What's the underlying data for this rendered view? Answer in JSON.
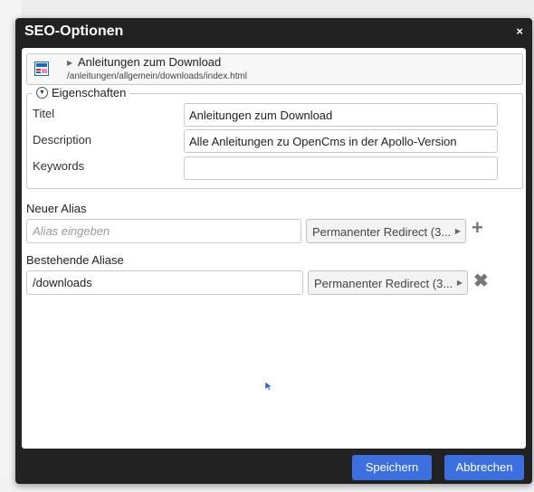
{
  "dialog": {
    "title": "SEO-Optionen",
    "close_glyph": "×",
    "resource": {
      "icon": "page-icon",
      "title": "Anleitungen zum Download",
      "path": "/anleitungen/allgemein/downloads/index.html"
    },
    "properties": {
      "legend": "Eigenschaften",
      "fields": [
        {
          "label": "Titel",
          "value": "Anleitungen zum Download"
        },
        {
          "label": "Description",
          "value": "Alle Anleitungen zu OpenCms in der Apollo-Version"
        },
        {
          "label": "Keywords",
          "value": ""
        }
      ]
    },
    "new_alias": {
      "label": "Neuer Alias",
      "placeholder": "Alias eingeben",
      "mode": "Permanenter Redirect (3...",
      "add_icon": "plus-icon"
    },
    "existing_aliases": {
      "label": "Bestehende Aliase",
      "items": [
        {
          "path": "/downloads",
          "mode": "Permanenter Redirect (3...",
          "delete_icon": "x-icon"
        }
      ]
    },
    "buttons": {
      "save": "Speichern",
      "cancel": "Abbrechen"
    }
  },
  "colors": {
    "titlebar": "#222222",
    "primary_button": "#3c6fe0",
    "icon_blue": "#1a66c4"
  }
}
